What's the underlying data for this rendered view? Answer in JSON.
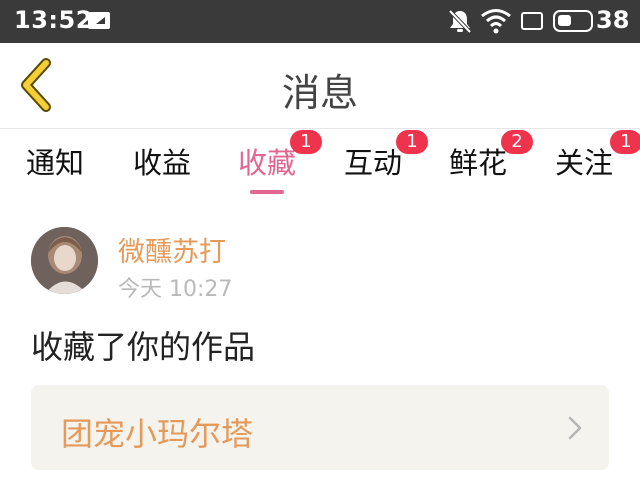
{
  "status_bar": {
    "time": "13:52",
    "battery": "38",
    "icons": [
      "sim-icon",
      "mute-icon",
      "wifi-icon",
      "screen-icon",
      "battery-icon"
    ]
  },
  "header": {
    "title": "消息",
    "back_icon": "chevron-left-icon"
  },
  "tabs": [
    {
      "label": "通知",
      "badge": null,
      "active": false
    },
    {
      "label": "收益",
      "badge": null,
      "active": false
    },
    {
      "label": "收藏",
      "badge": "1",
      "active": true
    },
    {
      "label": "互动",
      "badge": "1",
      "active": false
    },
    {
      "label": "鲜花",
      "badge": "2",
      "active": false
    },
    {
      "label": "关注",
      "badge": "1",
      "active": false
    }
  ],
  "message": {
    "sender": "微醺苏打",
    "time": "今天 10:27",
    "text": "收藏了你的作品",
    "work_title": "团宠小玛尔塔"
  },
  "colors": {
    "accent_pink": "#e2668f",
    "badge_red": "#f0334d",
    "name_orange": "#e59a5a",
    "back_yellow": "#f5cf36",
    "card_bg": "#f4f3ee"
  }
}
